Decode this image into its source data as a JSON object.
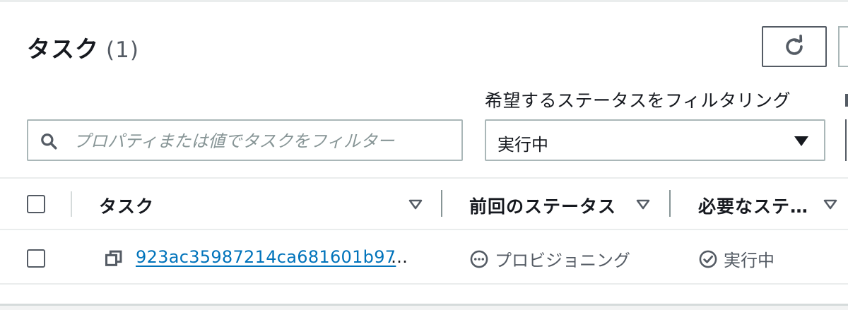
{
  "header": {
    "title": "タスク",
    "count": "(1)"
  },
  "filter": {
    "label": "希望するステータスをフィルタリング",
    "selected": "実行中"
  },
  "search": {
    "placeholder": "プロパティまたは値でタスクをフィルター"
  },
  "table": {
    "columns": [
      "タスク",
      "前回のステータス",
      "必要なステ…"
    ],
    "rows": [
      {
        "task_id": "923ac35987214ca681601b97",
        "truncation": "…",
        "last_status": "プロビジョニング",
        "desired_status": "実行中"
      }
    ]
  },
  "icons": {
    "refresh": "refresh-icon",
    "search": "search-icon",
    "copy": "copy-icon",
    "pending": "pending-icon",
    "success": "check-circle-icon"
  },
  "colors": {
    "link": "#0073bb",
    "text": "#16191f",
    "muted": "#545b64",
    "border": "#aab7b8"
  }
}
